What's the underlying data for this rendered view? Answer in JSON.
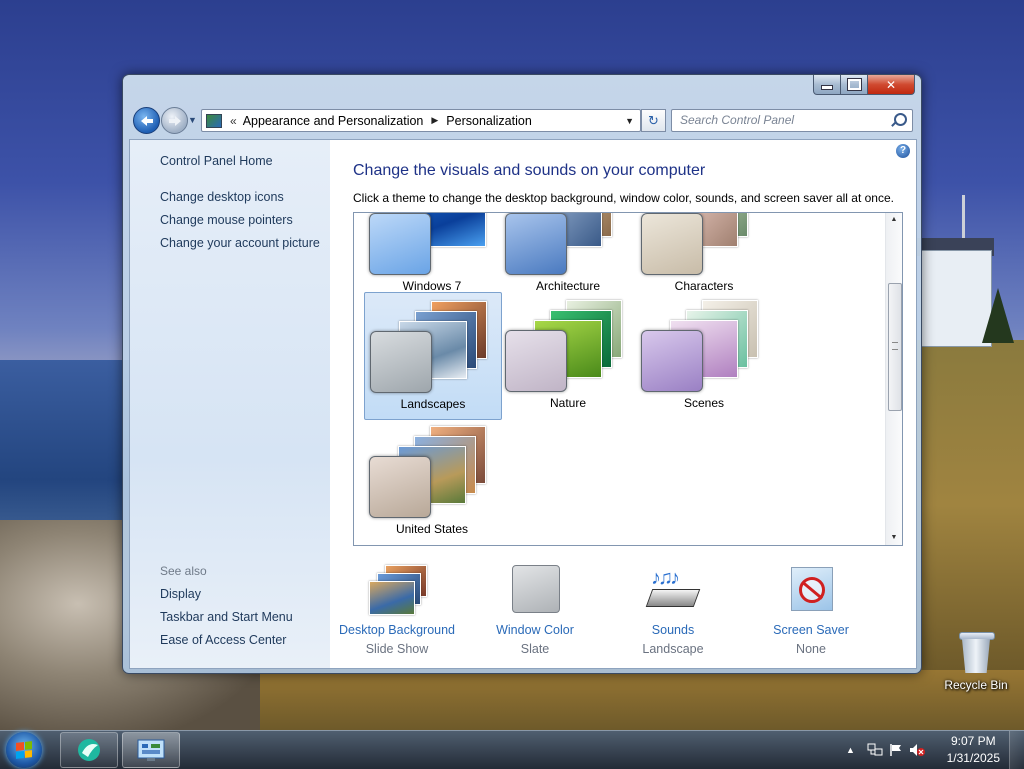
{
  "window": {
    "controls": {
      "minimize": "minimize",
      "maximize": "maximize",
      "close": "close"
    }
  },
  "nav": {
    "address_prefix": "«",
    "breadcrumb": [
      "Appearance and Personalization",
      "Personalization"
    ],
    "search_placeholder": "Search Control Panel"
  },
  "sidebar": {
    "home": "Control Panel Home",
    "links": [
      "Change desktop icons",
      "Change mouse pointers",
      "Change your account picture"
    ],
    "see_also_heading": "See also",
    "see_also": [
      "Display",
      "Taskbar and Start Menu",
      "Ease of Access Center"
    ]
  },
  "main": {
    "heading": "Change the visuals and sounds on your computer",
    "subtext": "Click a theme to change the desktop background, window color, sounds, and screen saver all at once.",
    "themes": [
      {
        "name": "Windows 7",
        "selected": false
      },
      {
        "name": "Architecture",
        "selected": false
      },
      {
        "name": "Characters",
        "selected": false
      },
      {
        "name": "Landscapes",
        "selected": true
      },
      {
        "name": "Nature",
        "selected": false
      },
      {
        "name": "Scenes",
        "selected": false
      },
      {
        "name": "United States",
        "selected": false
      }
    ],
    "quick_links": [
      {
        "label": "Desktop Background",
        "value": "Slide Show",
        "icon": "desktop-background-icon"
      },
      {
        "label": "Window Color",
        "value": "Slate",
        "icon": "window-color-icon"
      },
      {
        "label": "Sounds",
        "value": "Landscape",
        "icon": "sounds-icon"
      },
      {
        "label": "Screen Saver",
        "value": "None",
        "icon": "screen-saver-icon"
      }
    ]
  },
  "desktop": {
    "recycle_bin": "Recycle Bin"
  },
  "taskbar": {
    "time": "9:07 PM",
    "date": "1/31/2025",
    "tray_icons": [
      "show-hidden-icons",
      "network-icon",
      "action-center-flag-icon",
      "volume-muted-icon"
    ]
  },
  "colors": {
    "link": "#2a6ab8",
    "heading": "#1e3287",
    "side_link": "#1e395b",
    "muted": "#6a7280"
  }
}
